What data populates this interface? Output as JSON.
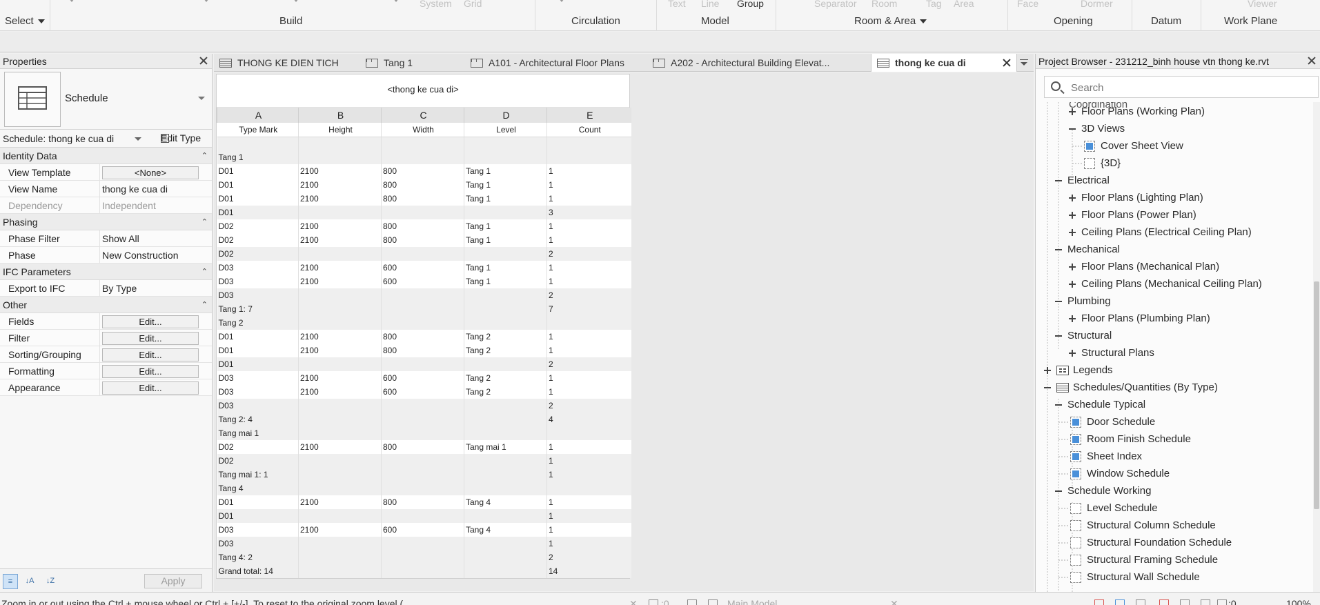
{
  "ribbon": {
    "select_label": "Select",
    "groups": [
      {
        "label": "Build"
      },
      {
        "label": "Circulation"
      },
      {
        "label": "Model"
      },
      {
        "label": "Room & Area"
      },
      {
        "label": "Opening"
      },
      {
        "label": "Datum"
      },
      {
        "label": "Work Plane"
      }
    ],
    "ghost_labels": [
      "System",
      "Grid",
      "Text",
      "Line",
      "Group",
      "Separator",
      "Room",
      "Tag",
      "Area",
      "Face",
      "Dormer",
      "Viewer"
    ]
  },
  "properties": {
    "title": "Properties",
    "type_name": "Schedule",
    "schedule_selector": "Schedule: thong ke cua di",
    "edit_type_label": "Edit Type",
    "categories": [
      {
        "label": "Identity Data",
        "rows": [
          {
            "label": "View Template",
            "value": "<None>",
            "kind": "button"
          },
          {
            "label": "View Name",
            "value": "thong ke cua di",
            "kind": "text"
          },
          {
            "label": "Dependency",
            "value": "Independent",
            "kind": "dim"
          }
        ]
      },
      {
        "label": "Phasing",
        "rows": [
          {
            "label": "Phase Filter",
            "value": "Show All",
            "kind": "text"
          },
          {
            "label": "Phase",
            "value": "New Construction",
            "kind": "text"
          }
        ]
      },
      {
        "label": "IFC Parameters",
        "rows": [
          {
            "label": "Export to IFC",
            "value": "By Type",
            "kind": "text"
          }
        ]
      },
      {
        "label": "Other",
        "rows": [
          {
            "label": "Fields",
            "value": "Edit...",
            "kind": "button"
          },
          {
            "label": "Filter",
            "value": "Edit...",
            "kind": "button"
          },
          {
            "label": "Sorting/Grouping",
            "value": "Edit...",
            "kind": "button"
          },
          {
            "label": "Formatting",
            "value": "Edit...",
            "kind": "button"
          },
          {
            "label": "Appearance",
            "value": "Edit...",
            "kind": "button"
          }
        ]
      }
    ],
    "apply_label": "Apply"
  },
  "tabs": [
    {
      "label": "THONG KE DIEN TICH",
      "icon": "table-icon",
      "active": false
    },
    {
      "label": "Tang 1",
      "icon": "floor-plan-icon",
      "active": false
    },
    {
      "label": "A101 - Architectural Floor Plans",
      "icon": "sheet-icon",
      "active": false
    },
    {
      "label": "A202 - Architectural Building Elevat...",
      "icon": "sheet-icon",
      "active": false
    },
    {
      "label": "thong ke cua di",
      "icon": "table-icon",
      "active": true
    }
  ],
  "schedule": {
    "title": "<thong ke cua di>",
    "column_letters": [
      "A",
      "B",
      "C",
      "D",
      "E"
    ],
    "column_headers": [
      "Type Mark",
      "Height",
      "Width",
      "Level",
      "Count"
    ],
    "rows": [
      {
        "kind": "group",
        "cells": [
          "Tang 1",
          "",
          "",
          "",
          ""
        ]
      },
      {
        "kind": "data",
        "cells": [
          "D01",
          "2100",
          "800",
          "Tang 1",
          "1"
        ]
      },
      {
        "kind": "data",
        "cells": [
          "D01",
          "2100",
          "800",
          "Tang 1",
          "1"
        ]
      },
      {
        "kind": "data",
        "cells": [
          "D01",
          "2100",
          "800",
          "Tang 1",
          "1"
        ]
      },
      {
        "kind": "sub",
        "cells": [
          "D01",
          "",
          "",
          "",
          "3"
        ]
      },
      {
        "kind": "data",
        "cells": [
          "D02",
          "2100",
          "800",
          "Tang 1",
          "1"
        ]
      },
      {
        "kind": "data",
        "cells": [
          "D02",
          "2100",
          "800",
          "Tang 1",
          "1"
        ]
      },
      {
        "kind": "sub",
        "cells": [
          "D02",
          "",
          "",
          "",
          "2"
        ]
      },
      {
        "kind": "data",
        "cells": [
          "D03",
          "2100",
          "600",
          "Tang 1",
          "1"
        ]
      },
      {
        "kind": "data",
        "cells": [
          "D03",
          "2100",
          "600",
          "Tang 1",
          "1"
        ]
      },
      {
        "kind": "sub",
        "cells": [
          "D03",
          "",
          "",
          "",
          "2"
        ]
      },
      {
        "kind": "sub",
        "cells": [
          "Tang 1: 7",
          "",
          "",
          "",
          "7"
        ]
      },
      {
        "kind": "group",
        "cells": [
          "Tang 2",
          "",
          "",
          "",
          ""
        ]
      },
      {
        "kind": "data",
        "cells": [
          "D01",
          "2100",
          "800",
          "Tang 2",
          "1"
        ]
      },
      {
        "kind": "data",
        "cells": [
          "D01",
          "2100",
          "800",
          "Tang 2",
          "1"
        ]
      },
      {
        "kind": "sub",
        "cells": [
          "D01",
          "",
          "",
          "",
          "2"
        ]
      },
      {
        "kind": "data",
        "cells": [
          "D03",
          "2100",
          "600",
          "Tang 2",
          "1"
        ]
      },
      {
        "kind": "data",
        "cells": [
          "D03",
          "2100",
          "600",
          "Tang 2",
          "1"
        ]
      },
      {
        "kind": "sub",
        "cells": [
          "D03",
          "",
          "",
          "",
          "2"
        ]
      },
      {
        "kind": "sub",
        "cells": [
          "Tang 2: 4",
          "",
          "",
          "",
          "4"
        ]
      },
      {
        "kind": "group",
        "cells": [
          "Tang mai 1",
          "",
          "",
          "",
          ""
        ]
      },
      {
        "kind": "data",
        "cells": [
          "D02",
          "2100",
          "800",
          "Tang mai 1",
          "1"
        ]
      },
      {
        "kind": "sub",
        "cells": [
          "D02",
          "",
          "",
          "",
          "1"
        ]
      },
      {
        "kind": "sub",
        "cells": [
          "Tang mai 1: 1",
          "",
          "",
          "",
          "1"
        ]
      },
      {
        "kind": "group",
        "cells": [
          "Tang 4",
          "",
          "",
          "",
          ""
        ]
      },
      {
        "kind": "data",
        "cells": [
          "D01",
          "2100",
          "800",
          "Tang 4",
          "1"
        ]
      },
      {
        "kind": "sub",
        "cells": [
          "D01",
          "",
          "",
          "",
          "1"
        ]
      },
      {
        "kind": "data",
        "cells": [
          "D03",
          "2100",
          "600",
          "Tang 4",
          "1"
        ]
      },
      {
        "kind": "sub",
        "cells": [
          "D03",
          "",
          "",
          "",
          "1"
        ]
      },
      {
        "kind": "sub",
        "cells": [
          "Tang 4: 2",
          "",
          "",
          "",
          "2"
        ]
      },
      {
        "kind": "sub",
        "cells": [
          "Grand total: 14",
          "",
          "",
          "",
          "14"
        ]
      }
    ]
  },
  "browser": {
    "title": "Project Browser - 231212_binh house vtn thong ke.rvt",
    "search_placeholder": "Search",
    "clipped_top_label": "Coordination",
    "nodes": [
      {
        "label": "Floor Plans (Working Plan)",
        "level": 2,
        "toggle": "plus",
        "icon": ""
      },
      {
        "label": "3D Views",
        "level": 2,
        "toggle": "minus",
        "icon": ""
      },
      {
        "label": "Cover Sheet View",
        "level": 3,
        "toggle": "",
        "icon": "view-blue"
      },
      {
        "label": "{3D}",
        "level": 3,
        "toggle": "",
        "icon": "view"
      },
      {
        "label": "Electrical",
        "level": 1,
        "toggle": "minus",
        "icon": ""
      },
      {
        "label": "Floor Plans (Lighting Plan)",
        "level": 2,
        "toggle": "plus",
        "icon": ""
      },
      {
        "label": "Floor Plans (Power Plan)",
        "level": 2,
        "toggle": "plus",
        "icon": ""
      },
      {
        "label": "Ceiling Plans (Electrical Ceiling Plan)",
        "level": 2,
        "toggle": "plus",
        "icon": ""
      },
      {
        "label": "Mechanical",
        "level": 1,
        "toggle": "minus",
        "icon": ""
      },
      {
        "label": "Floor Plans (Mechanical Plan)",
        "level": 2,
        "toggle": "plus",
        "icon": ""
      },
      {
        "label": "Ceiling Plans (Mechanical Ceiling Plan)",
        "level": 2,
        "toggle": "plus",
        "icon": ""
      },
      {
        "label": "Plumbing",
        "level": 1,
        "toggle": "minus",
        "icon": ""
      },
      {
        "label": "Floor Plans (Plumbing Plan)",
        "level": 2,
        "toggle": "plus",
        "icon": ""
      },
      {
        "label": "Structural",
        "level": 1,
        "toggle": "minus",
        "icon": ""
      },
      {
        "label": "Structural Plans",
        "level": 2,
        "toggle": "plus",
        "icon": ""
      },
      {
        "label": "Legends",
        "level": 0,
        "toggle": "plus",
        "icon": "legend"
      },
      {
        "label": "Schedules/Quantities (By Type)",
        "level": 0,
        "toggle": "minus",
        "icon": "schedule"
      },
      {
        "label": "Schedule Typical",
        "level": 1,
        "toggle": "minus",
        "icon": ""
      },
      {
        "label": "Door Schedule",
        "level": 2,
        "toggle": "",
        "icon": "view-blue"
      },
      {
        "label": "Room Finish Schedule",
        "level": 2,
        "toggle": "",
        "icon": "view-blue"
      },
      {
        "label": "Sheet Index",
        "level": 2,
        "toggle": "",
        "icon": "view-blue"
      },
      {
        "label": "Window Schedule",
        "level": 2,
        "toggle": "",
        "icon": "view-blue"
      },
      {
        "label": "Schedule Working",
        "level": 1,
        "toggle": "minus",
        "icon": ""
      },
      {
        "label": "Level Schedule",
        "level": 2,
        "toggle": "",
        "icon": "view"
      },
      {
        "label": "Structural Column Schedule",
        "level": 2,
        "toggle": "",
        "icon": "view"
      },
      {
        "label": "Structural Foundation Schedule",
        "level": 2,
        "toggle": "",
        "icon": "view"
      },
      {
        "label": "Structural Framing Schedule",
        "level": 2,
        "toggle": "",
        "icon": "view"
      },
      {
        "label": "Structural Wall Schedule",
        "level": 2,
        "toggle": "",
        "icon": "view"
      }
    ]
  },
  "status": {
    "hint": "Zoom in or out using the Ctrl + mouse wheel or Ctrl + [+/-]. To reset to the original zoom level (",
    "selection_count": ":0",
    "model_label": "Main Model",
    "filter_count": ":0",
    "zoom": "100%"
  },
  "colors": {
    "accent": "#4a90d9",
    "active_tab_bg": "#ffffff",
    "panel_bg": "#f7f7f7"
  }
}
